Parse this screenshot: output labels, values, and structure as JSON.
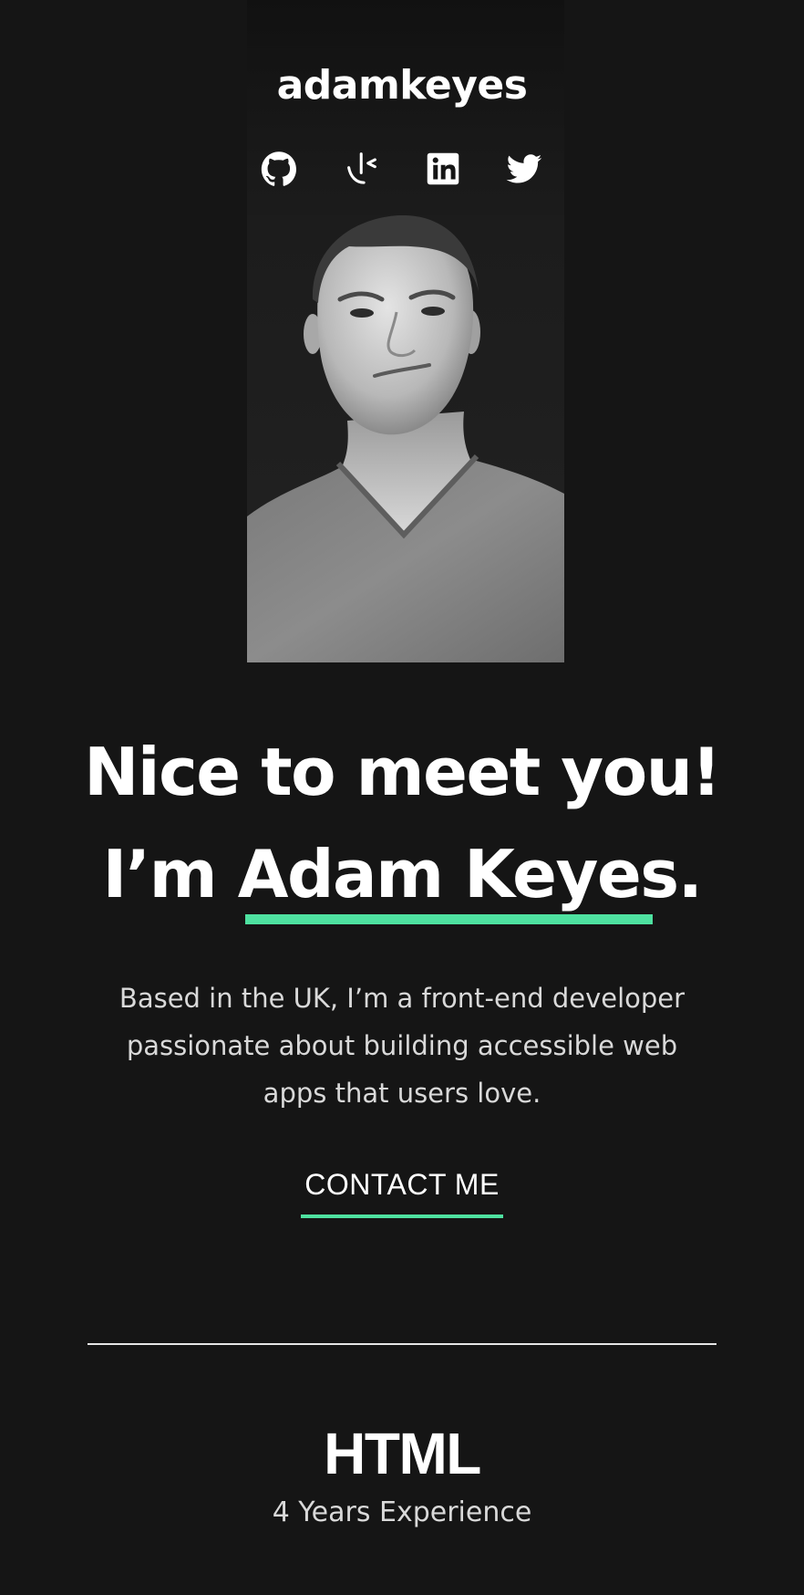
{
  "header": {
    "logo": "adamkeyes",
    "socials": [
      {
        "name": "GitHub",
        "icon": "github-icon"
      },
      {
        "name": "Frontend Mentor",
        "icon": "frontend-mentor-icon"
      },
      {
        "name": "LinkedIn",
        "icon": "linkedin-icon"
      },
      {
        "name": "Twitter",
        "icon": "twitter-icon"
      }
    ]
  },
  "hero": {
    "portrait_alt": "Adam Keyes portrait",
    "headline_line1": "Nice to meet you!",
    "headline_prefix": "I’m ",
    "headline_name": "Adam Keyes",
    "headline_suffix": ".",
    "intro": "Based in the UK, I’m a front-end developer passionate about building accessible web apps that users love.",
    "contact_label": "CONTACT ME"
  },
  "skills": [
    {
      "title": "HTML",
      "experience": "4 Years Experience"
    }
  ],
  "colors": {
    "background": "#151515",
    "accent": "#4ee1a0",
    "text": "#ffffff",
    "muted": "#d9d9d9"
  }
}
